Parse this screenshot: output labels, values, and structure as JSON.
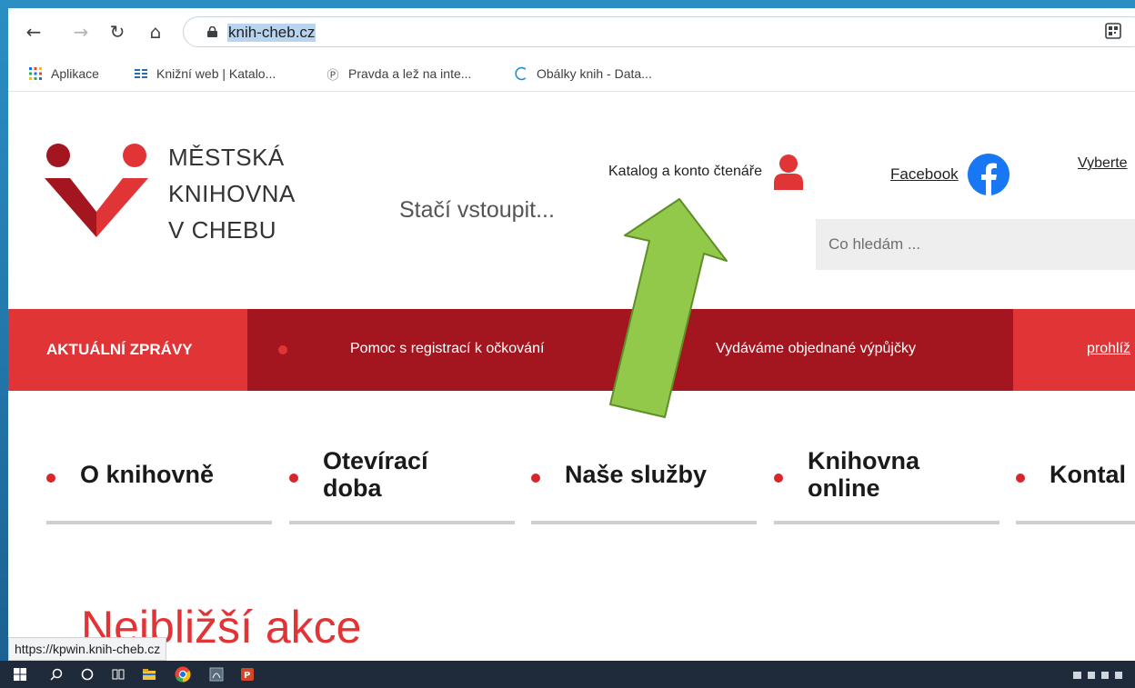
{
  "browser": {
    "url": "knih-cheb.cz",
    "status_url": "https://kpwin.knih-cheb.cz"
  },
  "bookmarks": [
    {
      "label": "Aplikace",
      "icon": "apps-grid-icon"
    },
    {
      "label": "Knižní web | Katalo...",
      "icon": "catalog-icon"
    },
    {
      "label": "Pravda a lež na inte...",
      "icon": "pravda-icon"
    },
    {
      "label": "Obálky knih - Data...",
      "icon": "obalky-icon"
    }
  ],
  "site": {
    "logo_lines": [
      "MĚSTSKÁ",
      "KNIHOVNA",
      "V CHEBU"
    ],
    "slogan": "Stačí vstoupit...",
    "catalog_link": "Katalog a konto čtenáře",
    "facebook_link": "Facebook",
    "language_link": "Vyberte",
    "search_placeholder": "Co hledám ...",
    "news_label": "AKTUÁLNÍ ZPRÁVY",
    "news_items": [
      "Pomoc s registrací k očkování",
      "Vydáváme objednané výpůjčky"
    ],
    "news_more": "prohlíž",
    "menu": [
      {
        "line1": "O knihovně",
        "line2": ""
      },
      {
        "line1": "Otevírací",
        "line2": "doba"
      },
      {
        "line1": "Naše služby",
        "line2": ""
      },
      {
        "line1": "Knihovna",
        "line2": "online"
      },
      {
        "line1": "Kontal",
        "line2": ""
      }
    ],
    "events_title": "Nejbližší akce"
  },
  "colors": {
    "brand_red": "#e03437",
    "dark_red": "#a3161f",
    "arrow_green": "#92c94a",
    "facebook_blue": "#1877f2"
  }
}
